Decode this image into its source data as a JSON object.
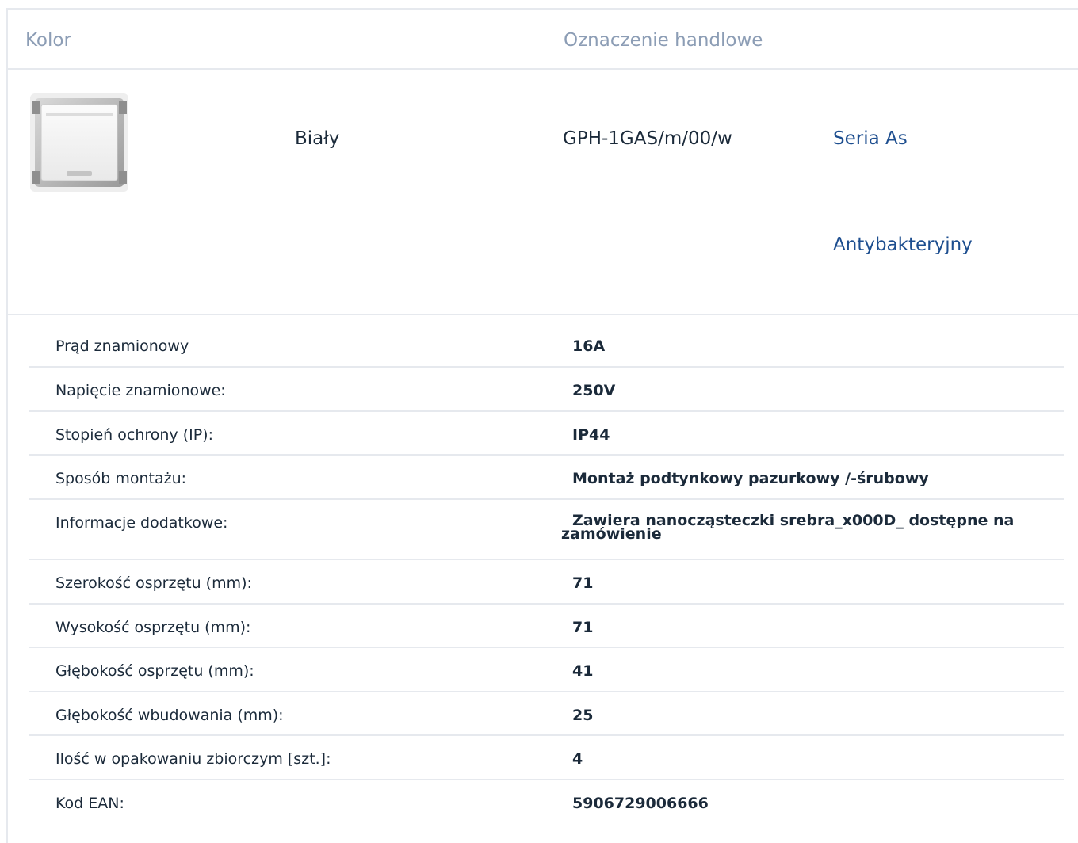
{
  "table_header": {
    "color_label": "Kolor",
    "trade_label": "Oznaczenie handlowe"
  },
  "product": {
    "image_icon": "socket-product-image",
    "color_name": "Biały",
    "trade_name": "GPH-1GAS/m/00/w",
    "links": [
      "Seria As",
      "Antybakteryjny"
    ]
  },
  "specs": [
    {
      "label": "Prąd znamionowy",
      "value": "16A"
    },
    {
      "label": "Napięcie znamionowe:",
      "value": "250V"
    },
    {
      "label": "Stopień ochrony (IP):",
      "value": "IP44"
    },
    {
      "label": "Sposób montażu:",
      "value": "Montaż podtynkowy pazurkowy /-śrubowy"
    },
    {
      "label": "Informacje dodatkowe:",
      "value": "Zawiera nanocząsteczki srebra_x000D_ dostępne na zamówienie"
    },
    {
      "label": "Szerokość osprzętu (mm):",
      "value": "71"
    },
    {
      "label": "Wysokość osprzętu (mm):",
      "value": "71"
    },
    {
      "label": "Głębokość osprzętu (mm):",
      "value": "41"
    },
    {
      "label": "Głębokość wbudowania (mm):",
      "value": "25"
    },
    {
      "label": "Ilość w opakowaniu zbiorczym [szt.]:",
      "value": "4"
    },
    {
      "label": "Kod EAN:",
      "value": "5906729006666"
    }
  ],
  "colors": {
    "header_text": "#8c9db5",
    "link": "#1d4e8f",
    "body_text": "#1b2a3a",
    "divider": "#e6e9ee"
  }
}
